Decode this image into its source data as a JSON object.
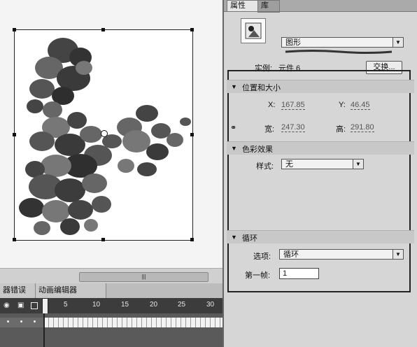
{
  "stage": {
    "scroll_grip": "|||"
  },
  "timeline": {
    "tabs": [
      "器错误",
      "动画编辑器"
    ],
    "frame_numbers": [
      "5",
      "10",
      "15",
      "20",
      "25",
      "30"
    ],
    "icons": [
      "eye-icon",
      "lock-icon",
      "outline-box-icon"
    ]
  },
  "panel": {
    "tabs": {
      "properties": "属性",
      "library": "库"
    },
    "symbol_type": "图形",
    "instance_label": "实例:",
    "instance_value": "元件 6",
    "swap_button": "交换...",
    "position_section": "位置和大小",
    "x_label": "X:",
    "x_value": "167.85",
    "y_label": "Y:",
    "y_value": "46.45",
    "w_label": "宽:",
    "w_value": "247.30",
    "h_label": "高:",
    "h_value": "291.80",
    "color_section": "色彩效果",
    "style_label": "样式:",
    "style_value": "无",
    "loop_section": "循环",
    "options_label": "选项:",
    "options_value": "循环",
    "first_frame_label": "第一帧:",
    "first_frame_value": "1"
  },
  "colors": {
    "panel_bg": "#d6d6d6",
    "frame_highlight": "#222222"
  }
}
